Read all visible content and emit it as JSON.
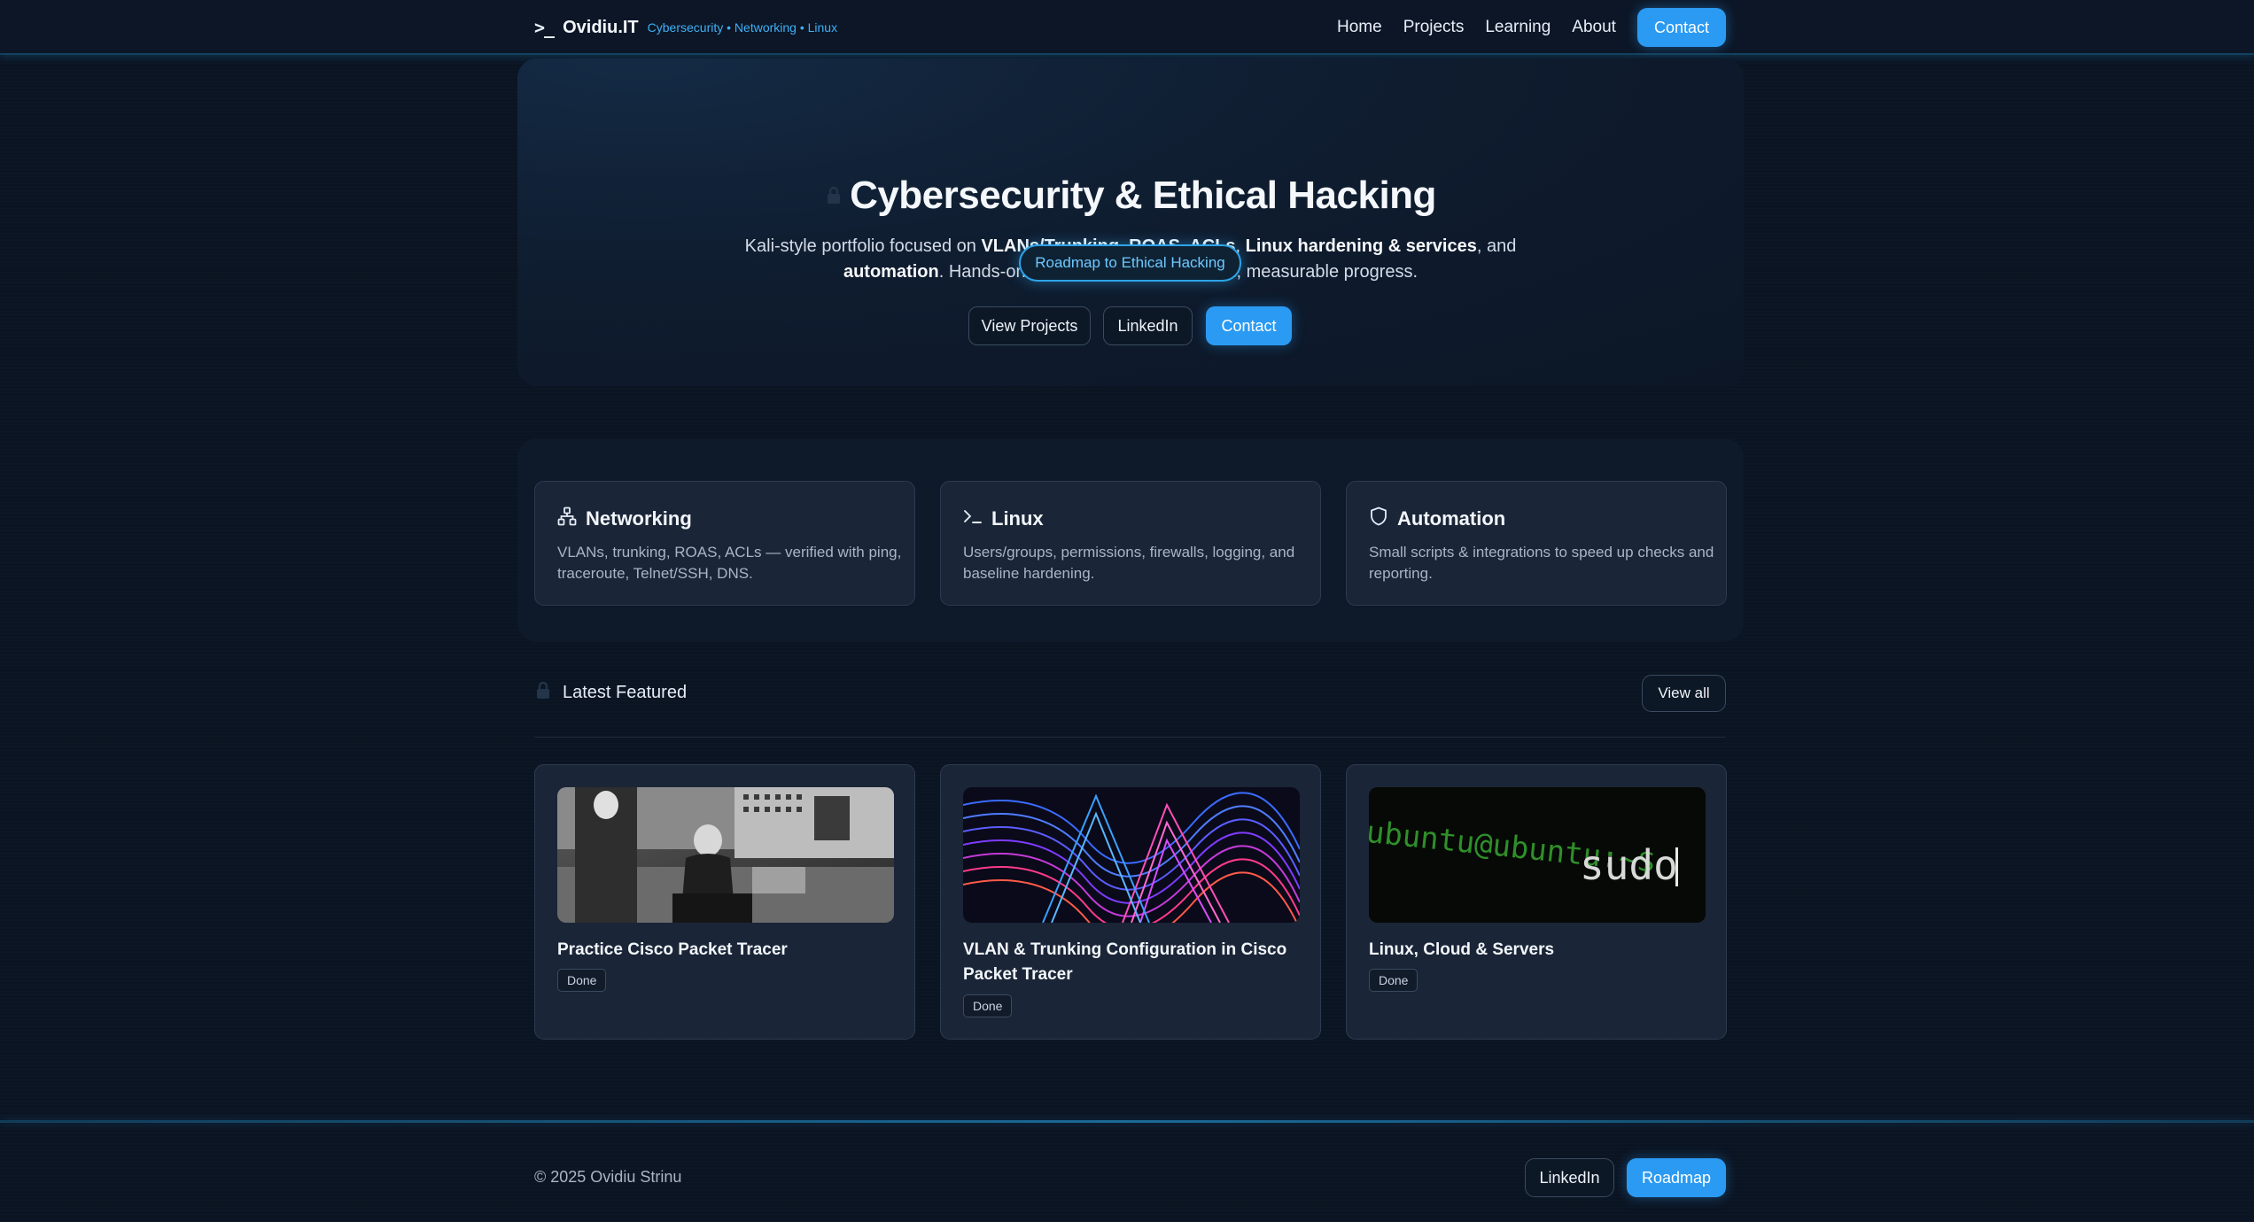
{
  "nav": {
    "prompt": ">_",
    "brand": "Ovidiu.IT",
    "tagline": "Cybersecurity • Networking • Linux",
    "links": [
      "Home",
      "Projects",
      "Learning",
      "About"
    ],
    "contact": "Contact"
  },
  "hero": {
    "title": "Cybersecurity & Ethical Hacking",
    "sub_1": "Kali-style portfolio focused on ",
    "sub_b1": "VLANs/Trunking, ROAS, ACLs",
    "sub_2": ", ",
    "sub_b2": "Linux hardening & services",
    "sub_3": ", and",
    "sub_b3": "automation",
    "sub_4": ". Hands-on labs, clean documentation, measurable progress.",
    "roadmap": "Roadmap to Ethical Hacking",
    "btn_projects": "View Projects",
    "btn_linkedin": "LinkedIn",
    "btn_contact": "Contact"
  },
  "features": [
    {
      "icon": "network-icon",
      "title": "Networking",
      "desc": "VLANs, trunking, ROAS, ACLs — verified with ping, traceroute, Telnet/SSH, DNS."
    },
    {
      "icon": "terminal-icon",
      "title": "Linux",
      "desc": "Users/groups, permissions, firewalls, logging, and baseline hardening."
    },
    {
      "icon": "shield-icon",
      "title": "Automation",
      "desc": "Small scripts & integrations to speed up checks and reporting."
    }
  ],
  "latest": {
    "title": "Latest Featured",
    "view_all": "View all",
    "projects": [
      {
        "title": "Practice Cisco Packet Tracer",
        "status": "Done"
      },
      {
        "title": "VLAN & Trunking Configuration in Cisco Packet Tracer",
        "status": "Done"
      },
      {
        "title": "Linux, Cloud & Servers",
        "status": "Done",
        "thumb_text_1": "ubuntu@ubuntu:~$",
        "thumb_text_2": "sudo"
      }
    ]
  },
  "footer": {
    "copyright": "© 2025 Ovidiu Strinu",
    "linkedin": "LinkedIn",
    "roadmap": "Roadmap"
  },
  "colors": {
    "accent": "#2a9af2",
    "background": "#0b1422",
    "card": "#1a2537"
  }
}
